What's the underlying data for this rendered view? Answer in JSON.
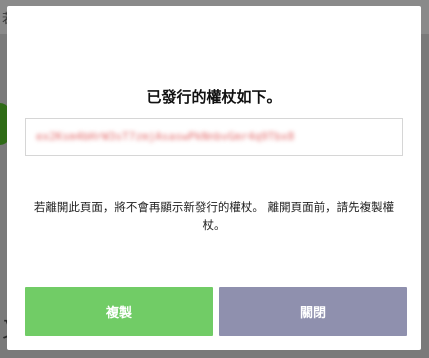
{
  "background": {
    "top_text": "若",
    "bottom_text": "又"
  },
  "modal": {
    "title": "已發行的權杖如下。",
    "token": "ex2Ksm4bHrW3sT7zmjAsaswPkNnbvGmr4q9Tbx8",
    "message": "若離開此頁面，將不會再顯示新發行的權杖。 離開頁面前，請先複製權杖。",
    "copy_label": "複製",
    "close_label": "關閉"
  },
  "colors": {
    "copy_button": "#71cc66",
    "close_button": "#8f90ae",
    "token_text": "#e36b6b"
  }
}
